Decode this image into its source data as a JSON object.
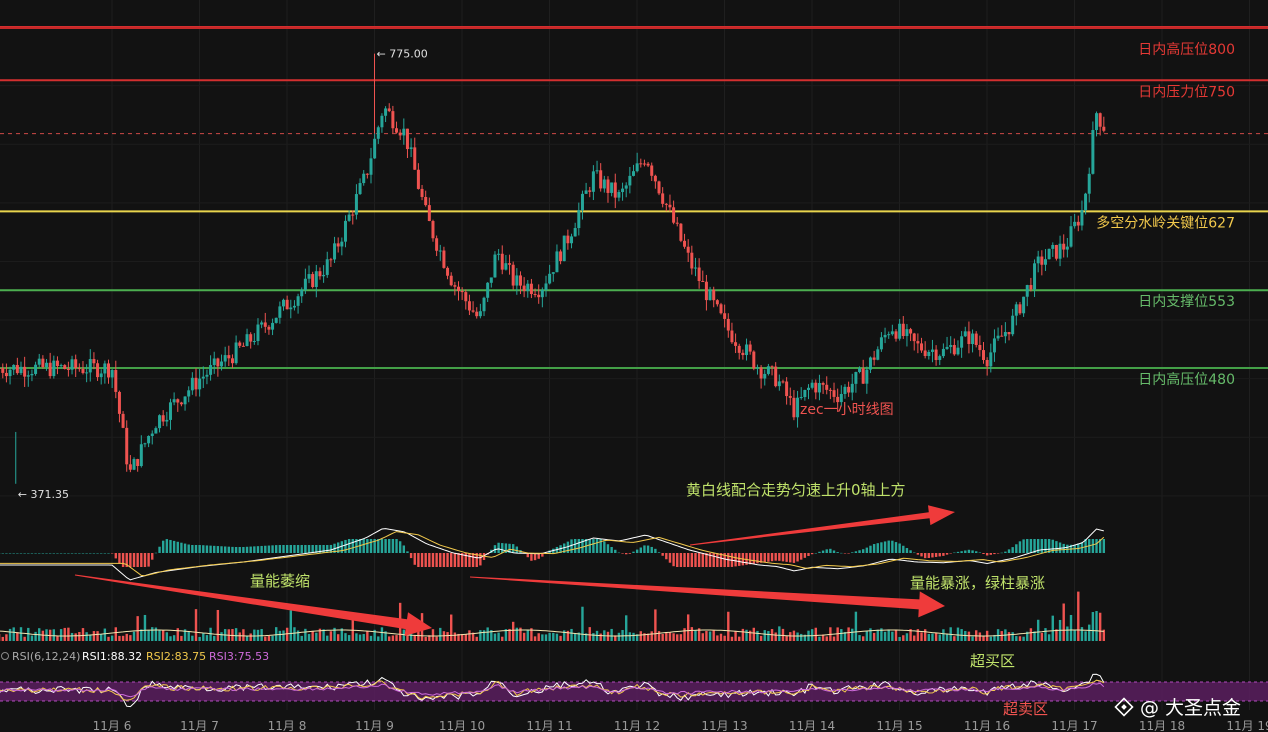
{
  "chart_data": [
    {
      "type": "candlestick",
      "title": "zec一小时线图",
      "price_range": [
        340,
        820
      ],
      "x_categories": [
        "11月 6",
        "11月 7",
        "11月 8",
        "11月 9",
        "11月 10",
        "11月 11",
        "11月 12",
        "11月 13",
        "11月 14",
        "11月 15",
        "11月 16",
        "11月 17",
        "11月 18",
        "11月 19"
      ],
      "high_marker": "775.00",
      "low_marker": "371.35",
      "current_price": 700,
      "levels": [
        {
          "label": "日内高压位800",
          "price": 800,
          "color": "#d32f2f",
          "text_color": "#e53935"
        },
        {
          "label": "日内压力位750",
          "price": 750,
          "color": "#d32f2f",
          "text_color": "#e53935"
        },
        {
          "label": "多空分水岭关键位627",
          "price": 627,
          "color": "#e8d44d",
          "text_color": "#f2c94c"
        },
        {
          "label": "日内支撑位553",
          "price": 553,
          "color": "#4caf50",
          "text_color": "#66bb6a"
        },
        {
          "label": "日内高压位480",
          "price": 480,
          "color": "#43a047",
          "text_color": "#66bb6a"
        }
      ],
      "key_points": [
        {
          "time": 0,
          "price": 480
        },
        {
          "time": 0.2,
          "price": 380
        },
        {
          "time": 0.5,
          "price": 430
        },
        {
          "time": 1.0,
          "price": 470
        },
        {
          "time": 1.5,
          "price": 500
        },
        {
          "time": 2.0,
          "price": 540
        },
        {
          "time": 2.5,
          "price": 580
        },
        {
          "time": 2.9,
          "price": 660
        },
        {
          "time": 3.1,
          "price": 725
        },
        {
          "time": 3.35,
          "price": 700
        },
        {
          "time": 3.6,
          "price": 620
        },
        {
          "time": 3.9,
          "price": 560
        },
        {
          "time": 4.2,
          "price": 525
        },
        {
          "time": 4.4,
          "price": 590
        },
        {
          "time": 4.6,
          "price": 560
        },
        {
          "time": 4.9,
          "price": 555
        },
        {
          "time": 5.2,
          "price": 600
        },
        {
          "time": 5.5,
          "price": 660
        },
        {
          "time": 5.8,
          "price": 640
        },
        {
          "time": 6.1,
          "price": 680
        },
        {
          "time": 6.4,
          "price": 620
        },
        {
          "time": 6.6,
          "price": 580
        },
        {
          "time": 6.8,
          "price": 550
        },
        {
          "time": 7.0,
          "price": 520
        },
        {
          "time": 7.2,
          "price": 500
        },
        {
          "time": 7.4,
          "price": 480
        },
        {
          "time": 7.6,
          "price": 470
        },
        {
          "time": 7.8,
          "price": 440
        },
        {
          "time": 8.0,
          "price": 465
        },
        {
          "time": 8.3,
          "price": 455
        },
        {
          "time": 8.6,
          "price": 475
        },
        {
          "time": 8.9,
          "price": 520
        },
        {
          "time": 9.2,
          "price": 500
        },
        {
          "time": 9.5,
          "price": 495
        },
        {
          "time": 9.8,
          "price": 510
        },
        {
          "time": 10.0,
          "price": 490
        },
        {
          "time": 10.3,
          "price": 525
        },
        {
          "time": 10.6,
          "price": 580
        },
        {
          "time": 10.9,
          "price": 595
        },
        {
          "time": 11.1,
          "price": 630
        },
        {
          "time": 11.25,
          "price": 720
        },
        {
          "time": 11.35,
          "price": 705
        }
      ],
      "annotations": [
        "黄白线配合走势匀速上升0轴上方",
        "量能萎缩",
        "量能暴涨，绿柱暴涨",
        "超买区",
        "超卖区"
      ],
      "rsi": {
        "label": "RSI(6,12,24)",
        "rsi1": "RSI1:88.32",
        "rsi2": "RSI2:83.75",
        "rsi3": "RSI3:75.53",
        "colors": {
          "rsi1": "#ffffff",
          "rsi2": "#f2c94c",
          "rsi3": "#ce6bdb"
        }
      }
    }
  ],
  "watermark": "@ 大圣点金",
  "colors": {
    "up": "#26a69a",
    "down": "#ef5350",
    "bg": "#121212",
    "arrow": "#ef3b3b"
  }
}
